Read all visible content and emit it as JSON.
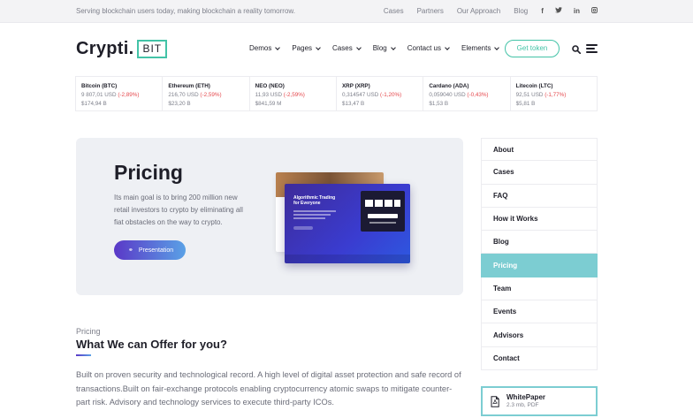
{
  "topbar": {
    "tagline": "Serving blockchain users today, making blockchain a reality tomorrow.",
    "links": [
      "Cases",
      "Partners",
      "Our Approach",
      "Blog"
    ],
    "social": [
      "f",
      "t",
      "in",
      "ig"
    ]
  },
  "logo": {
    "word": "Crypti.",
    "badge": "BIT",
    "accent": "#43c3a7"
  },
  "nav": {
    "items": [
      "Demos",
      "Pages",
      "Cases",
      "Blog",
      "Contact us",
      "Elements"
    ],
    "cta": "Get token"
  },
  "ticker": [
    {
      "name": "Bitcoin (BTC)",
      "price": "9 807,01 USD",
      "change": "(-2,89%)",
      "cap": "$174,94 B"
    },
    {
      "name": "Ethereum (ETH)",
      "price": "216,70 USD",
      "change": "(-2,59%)",
      "cap": "$23,20 B"
    },
    {
      "name": "NEO (NEO)",
      "price": "11,93 USD",
      "change": "(-2,59%)",
      "cap": "$841,59 M"
    },
    {
      "name": "XRP (XRP)",
      "price": "0,314547 USD",
      "change": "(-1,20%)",
      "cap": "$13,47 B"
    },
    {
      "name": "Cardano (ADA)",
      "price": "0,059040 USD",
      "change": "(-0,43%)",
      "cap": "$1,53 B"
    },
    {
      "name": "Litecoin (LTC)",
      "price": "92,51 USD",
      "change": "(-1,77%)",
      "cap": "$5,81 B"
    }
  ],
  "hero": {
    "title": "Pricing",
    "description": "Its main goal is to bring 200 million new retail investors to crypto by eliminating all fiat obstacles on the way to crypto.",
    "button": "Presentation",
    "mockup_title": "Algorithmic Trading for Everyone"
  },
  "content": {
    "eyebrow": "Pricing",
    "heading": "What We can Offer for you?",
    "paragraph": "Built on proven security and technological record. A high level of digital asset protection and safe record of transactions.Built on fair-exchange protocols enabling cryptocurrency atomic swaps to mitigate counter-part risk. Advisory and technology services to execute third-party ICOs."
  },
  "sidebar": {
    "items": [
      "About",
      "Cases",
      "FAQ",
      "How it Works",
      "Blog",
      "Pricing",
      "Team",
      "Events",
      "Advisors",
      "Contact"
    ],
    "active": "Pricing",
    "whitepaper_title": "WhitePaper",
    "whitepaper_meta": "2.3 mb, PDF"
  },
  "colors": {
    "accent": "#43c3a7",
    "sidebar_active": "#7ccdd2",
    "negative": "#e5484d",
    "button_start": "#5a38c7",
    "button_end": "#5aa1e6"
  }
}
